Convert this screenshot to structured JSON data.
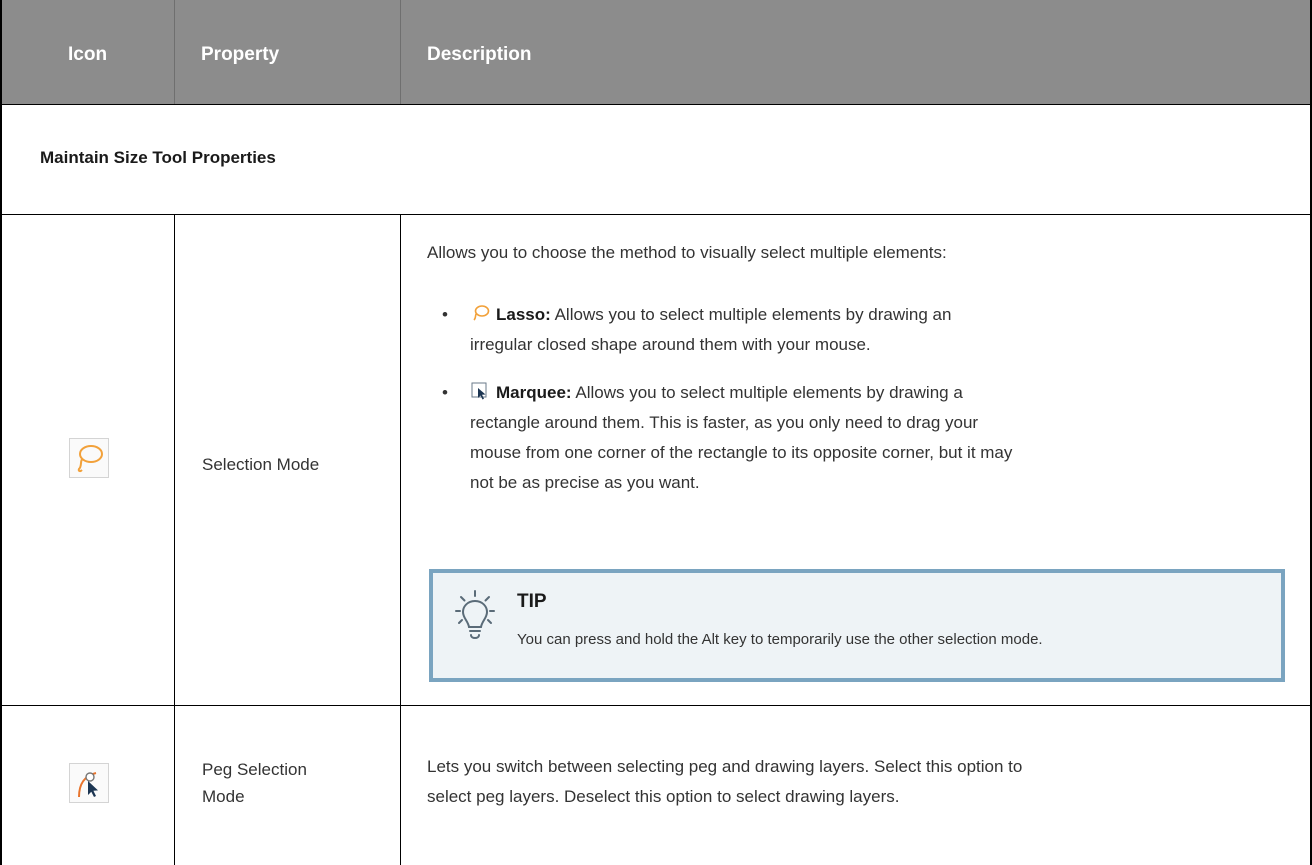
{
  "header": {
    "col_icon": "Icon",
    "col_property": "Property",
    "col_description": "Description"
  },
  "section_title": "Maintain Size Tool Properties",
  "rows": [
    {
      "icon": "lasso-icon",
      "property": "Selection Mode",
      "description": "Allows you to choose the method to visually select multiple elements:",
      "bullets": [
        {
          "icon": "lasso-icon",
          "term": "Lasso:",
          "line1": "Allows you to select multiple elements by drawing an",
          "line2": "irregular closed shape around them with your mouse."
        },
        {
          "icon": "marquee-icon",
          "term": "Marquee:",
          "line1": "Allows you to select multiple elements by drawing a",
          "line2": "rectangle around them. This is faster, as you only need to drag your",
          "line3": "mouse from one corner of the rectangle to its opposite corner, but it may",
          "line4": "not be as precise as you want."
        }
      ],
      "tip": {
        "title": "TIP",
        "text": "You can press and hold the Alt key to temporarily use the other selection mode."
      }
    },
    {
      "icon": "peg-selection-icon",
      "property_line1": "Peg Selection",
      "property_line2": "Mode",
      "description_line1": "Lets you switch between selecting peg and drawing layers. Select this option to",
      "description_line2": "select peg layers. Deselect this option to select drawing layers."
    }
  ],
  "colors": {
    "header_bg": "#8c8c8c",
    "tip_border": "#7aa4c0",
    "tip_bg": "#eef3f6",
    "lasso_orange": "#f2a13a"
  }
}
